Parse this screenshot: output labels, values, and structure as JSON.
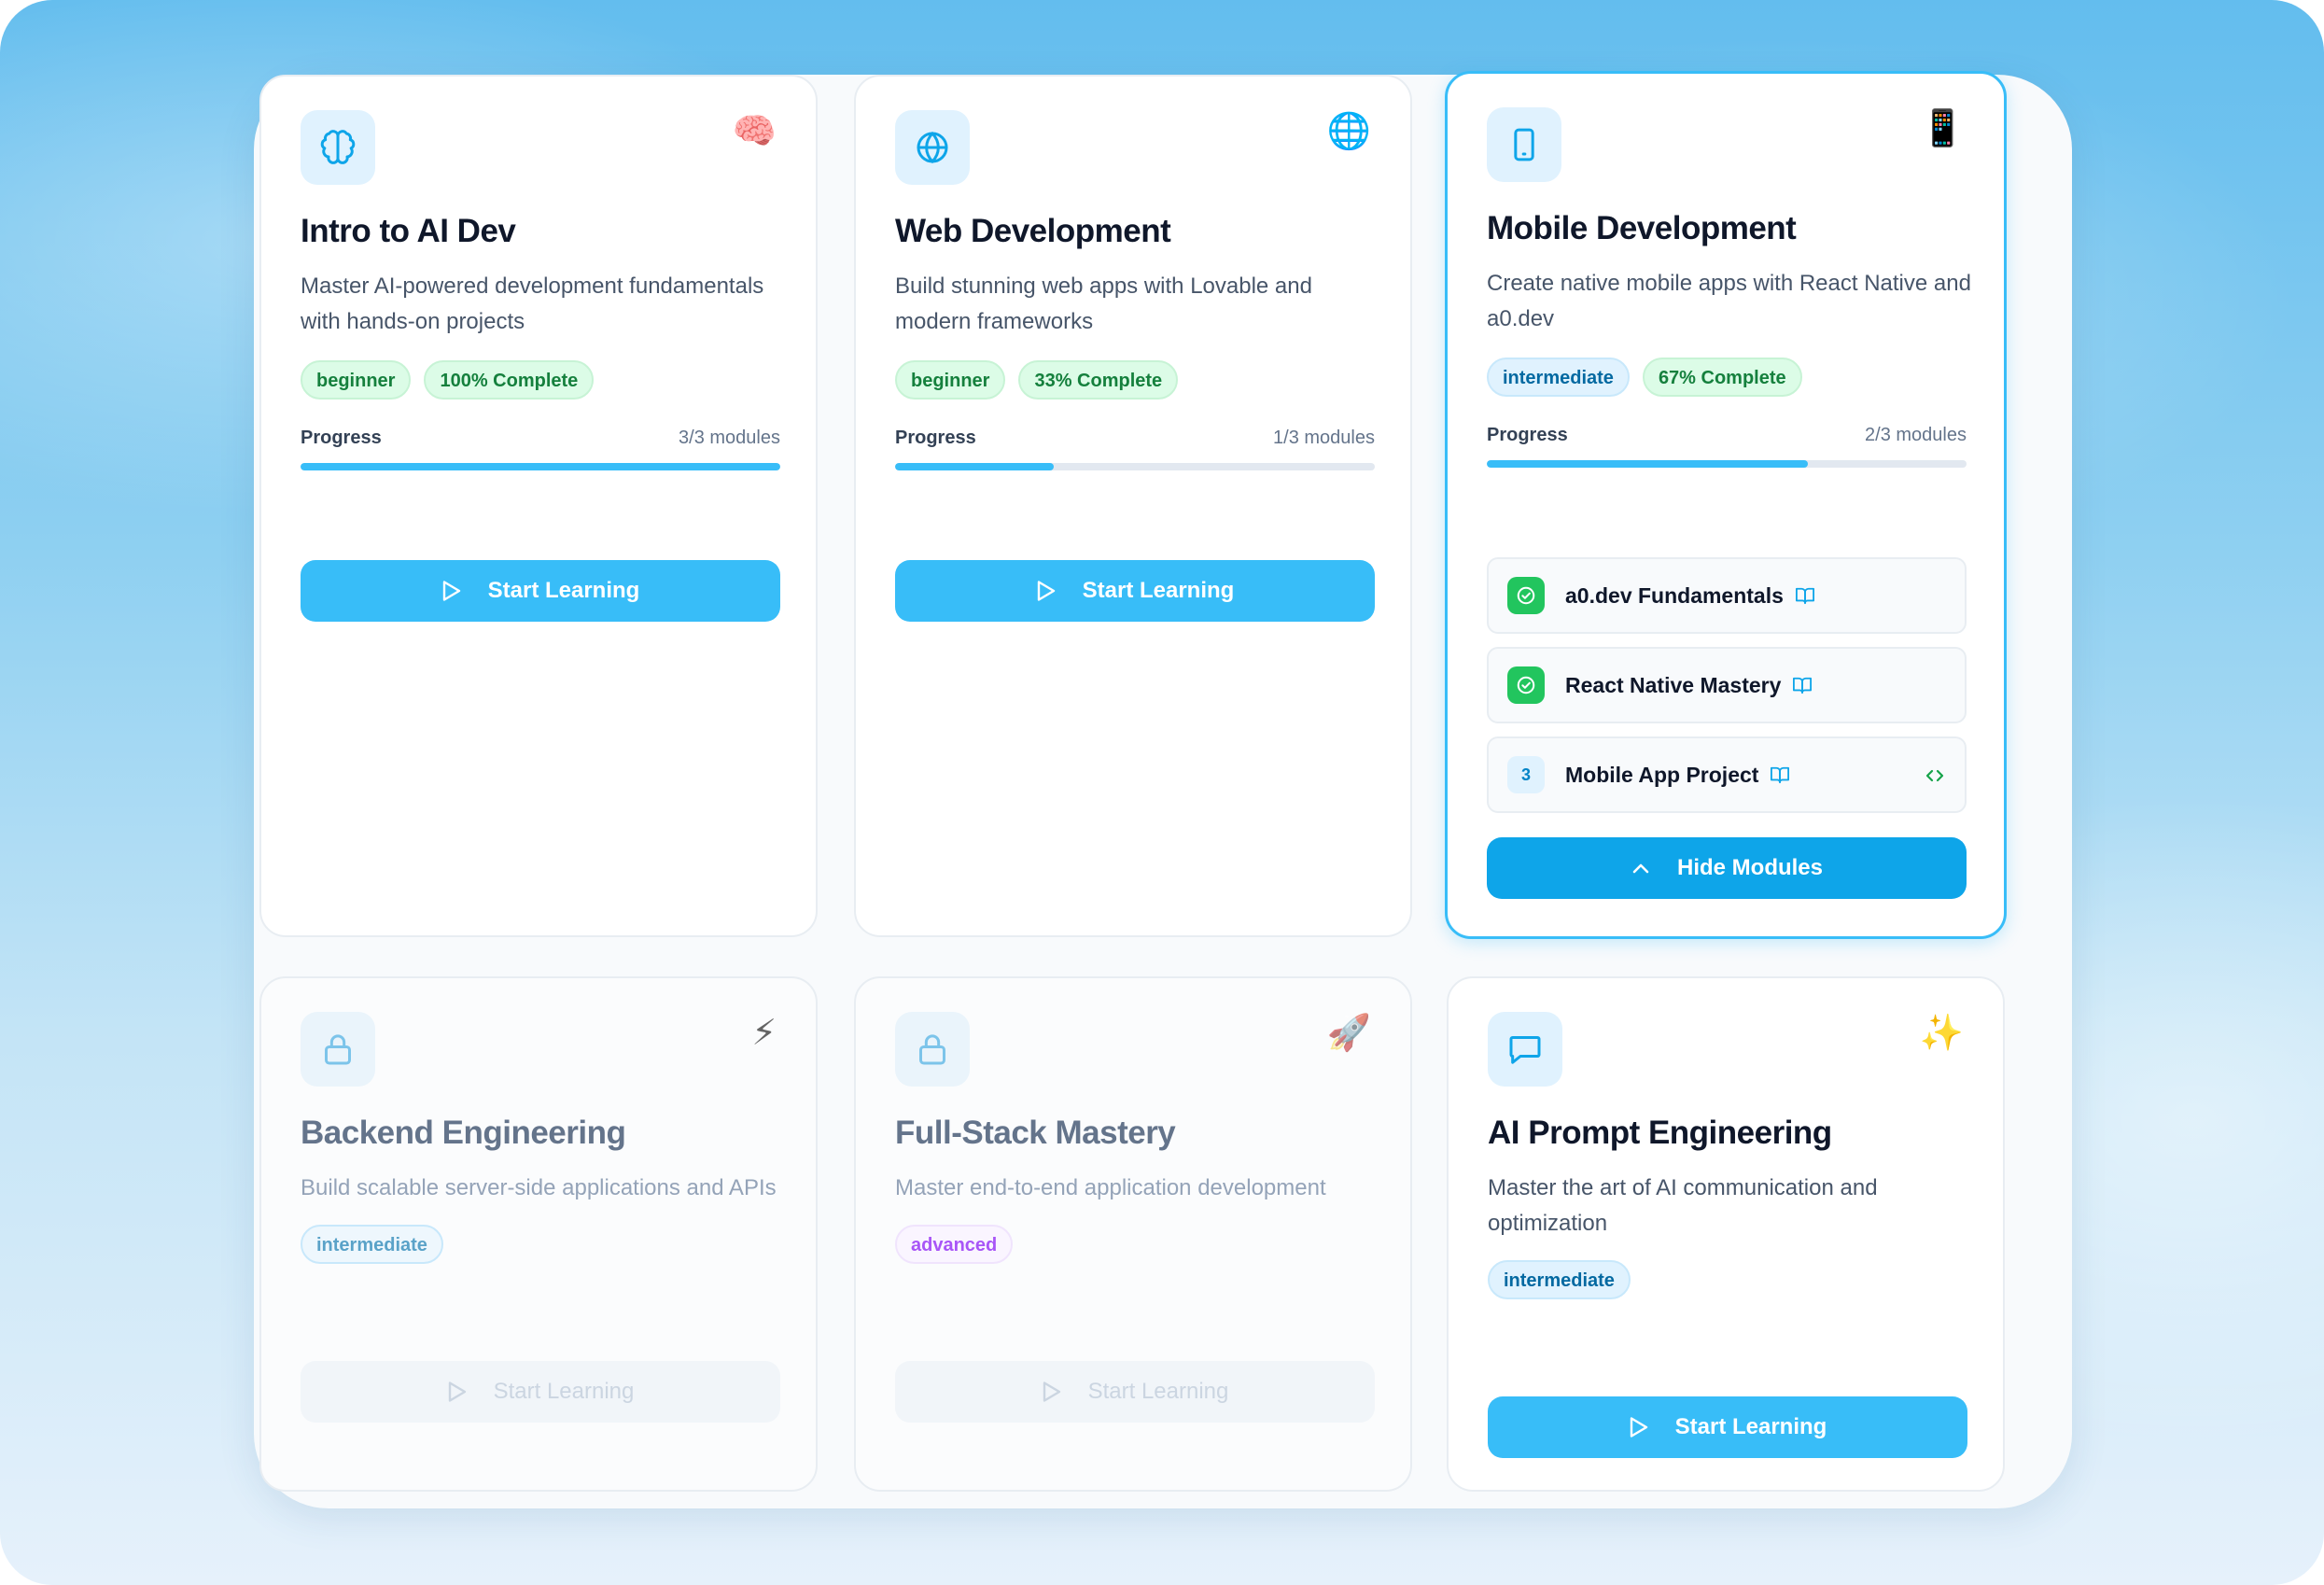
{
  "courses": [
    {
      "id": "intro-ai",
      "icon": "brain-icon",
      "emoji": "🧠",
      "title": "Intro to AI Dev",
      "description": "Master AI-powered development fundamentals with hands-on projects",
      "level": "beginner",
      "completion_label": "100% Complete",
      "progress_label": "Progress",
      "modules_label": "3/3 modules",
      "progress": 1.0,
      "button_label": "Start Learning",
      "locked": false
    },
    {
      "id": "web-dev",
      "icon": "globe-icon",
      "emoji": "🌐",
      "title": "Web Development",
      "description": "Build stunning web apps with Lovable and modern frameworks",
      "level": "beginner",
      "completion_label": "33% Complete",
      "progress_label": "Progress",
      "modules_label": "1/3 modules",
      "progress": 0.33,
      "button_label": "Start Learning",
      "locked": false
    },
    {
      "id": "mobile-dev",
      "icon": "phone-icon",
      "emoji": "📱",
      "title": "Mobile Development",
      "description": "Create native mobile apps with React Native and a0.dev",
      "level": "intermediate",
      "completion_label": "67% Complete",
      "progress_label": "Progress",
      "modules_label": "2/3 modules",
      "progress": 0.67,
      "button_label": "Hide Modules",
      "locked": false,
      "modules": [
        {
          "status": "done",
          "name": "a0.dev Fundamentals"
        },
        {
          "status": "done",
          "name": "React Native Mastery"
        },
        {
          "status": "number",
          "number": "3",
          "name": "Mobile App Project"
        }
      ]
    },
    {
      "id": "backend",
      "icon": "lock-icon",
      "emoji": "⚡",
      "title": "Backend Engineering",
      "description": "Build scalable server-side applications and APIs",
      "level": "intermediate",
      "button_label": "Start Learning",
      "locked": true
    },
    {
      "id": "fullstack",
      "icon": "lock-icon",
      "emoji": "🚀",
      "title": "Full-Stack Mastery",
      "description": "Master end-to-end application development",
      "level": "advanced",
      "button_label": "Start Learning",
      "locked": true
    },
    {
      "id": "prompt-eng",
      "icon": "chat-icon",
      "emoji": "✨",
      "title": "AI Prompt Engineering",
      "description": "Master the art of AI communication and optimization",
      "level": "intermediate",
      "button_label": "Start Learning",
      "locked": false
    }
  ],
  "colors": {
    "accent": "#38bdf8",
    "accent_dark": "#0ea5e9",
    "success": "#22c55e",
    "title": "#0f172a"
  }
}
